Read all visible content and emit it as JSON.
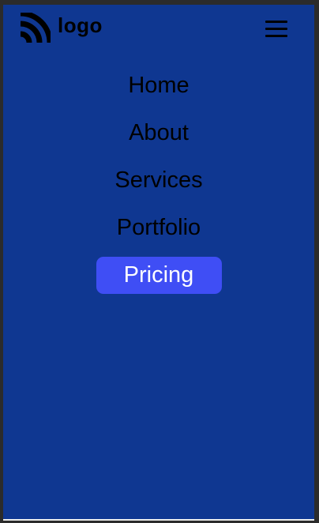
{
  "brand": {
    "logo_text": "logo",
    "logo_icon": "wifi-arcs-icon"
  },
  "header": {
    "menu_icon": "hamburger-menu-icon"
  },
  "nav": {
    "items": [
      {
        "label": "Home",
        "active": false
      },
      {
        "label": "About",
        "active": false
      },
      {
        "label": "Services",
        "active": false
      },
      {
        "label": "Portfolio",
        "active": false
      },
      {
        "label": "Pricing",
        "active": true
      }
    ]
  },
  "colors": {
    "page_background": "#0f3791",
    "active_item_background": "#3f4ef5",
    "active_item_text": "#ffffff",
    "text": "#000000",
    "frame": "#2b2b2b"
  }
}
